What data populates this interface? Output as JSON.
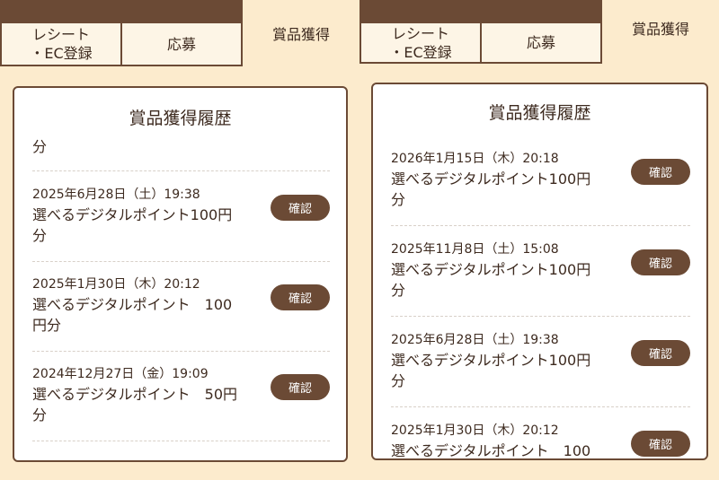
{
  "tabs": {
    "receipt_line1": "レシート",
    "receipt_line2": "・EC登録",
    "apply": "応募",
    "prize": "賞品獲得"
  },
  "history_title": "賞品獲得履歴",
  "confirm_label": "確認",
  "left_panel": {
    "partial_text": "分",
    "entries": [
      {
        "date": "2025年6月28日（土）19:38",
        "prize": "選べるデジタルポイント100円分"
      },
      {
        "date": "2025年1月30日（木）20:12",
        "prize": "選べるデジタルポイント　100円分"
      },
      {
        "date": "2024年12月27日（金）19:09",
        "prize": "選べるデジタルポイント　50円分"
      }
    ]
  },
  "right_panel": {
    "entries": [
      {
        "date": "2026年1月15日（木）20:18",
        "prize": "選べるデジタルポイント100円分"
      },
      {
        "date": "2025年11月8日（土）15:08",
        "prize": "選べるデジタルポイント100円分"
      },
      {
        "date": "2025年6月28日（土）19:38",
        "prize": "選べるデジタルポイント100円分"
      },
      {
        "date": "2025年1月30日（木）20:12",
        "prize": "選べるデジタルポイント　100"
      }
    ]
  }
}
